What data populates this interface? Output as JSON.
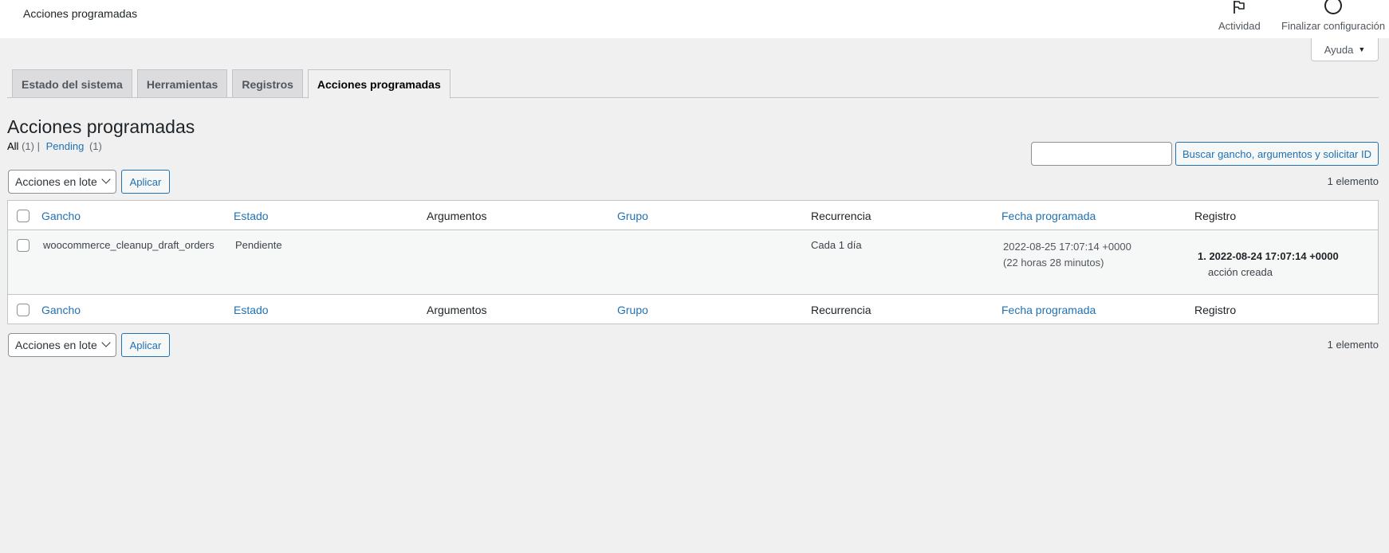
{
  "header": {
    "title": "Acciones programadas",
    "activity_label": "Actividad",
    "setup_label": "Finalizar configuración"
  },
  "help": {
    "label": "Ayuda"
  },
  "tabs": [
    {
      "label": "Estado del sistema"
    },
    {
      "label": "Herramientas"
    },
    {
      "label": "Registros"
    },
    {
      "label": "Acciones programadas",
      "active": true
    }
  ],
  "page": {
    "title": "Acciones programadas",
    "filters": {
      "all_label": "All",
      "all_count": "(1)",
      "separator": "|",
      "pending_label": "Pending",
      "pending_count": "(1)"
    }
  },
  "search": {
    "value": "",
    "button_label": "Buscar gancho, argumentos y solicitar ID"
  },
  "bulk": {
    "select_value": "Acciones en lote",
    "apply_label": "Aplicar",
    "count_label": "1 elemento"
  },
  "table": {
    "columns": [
      "Gancho",
      "Estado",
      "Argumentos",
      "Grupo",
      "Recurrencia",
      "Fecha programada",
      "Registro"
    ],
    "rows": [
      {
        "hook": "woocommerce_cleanup_draft_orders",
        "status": "Pendiente",
        "arguments": "",
        "group": "",
        "recurrence": "Cada 1 día",
        "scheduled_date": "2022-08-25 17:07:14 +0000",
        "scheduled_relative": "(22 horas 28 minutos)",
        "log_date": "1. 2022-08-24 17:07:14 +0000",
        "log_message": "acción creada"
      }
    ]
  },
  "colors": {
    "link": "#2271b1",
    "background": "#f0f0f1",
    "border": "#c3c4c7"
  }
}
